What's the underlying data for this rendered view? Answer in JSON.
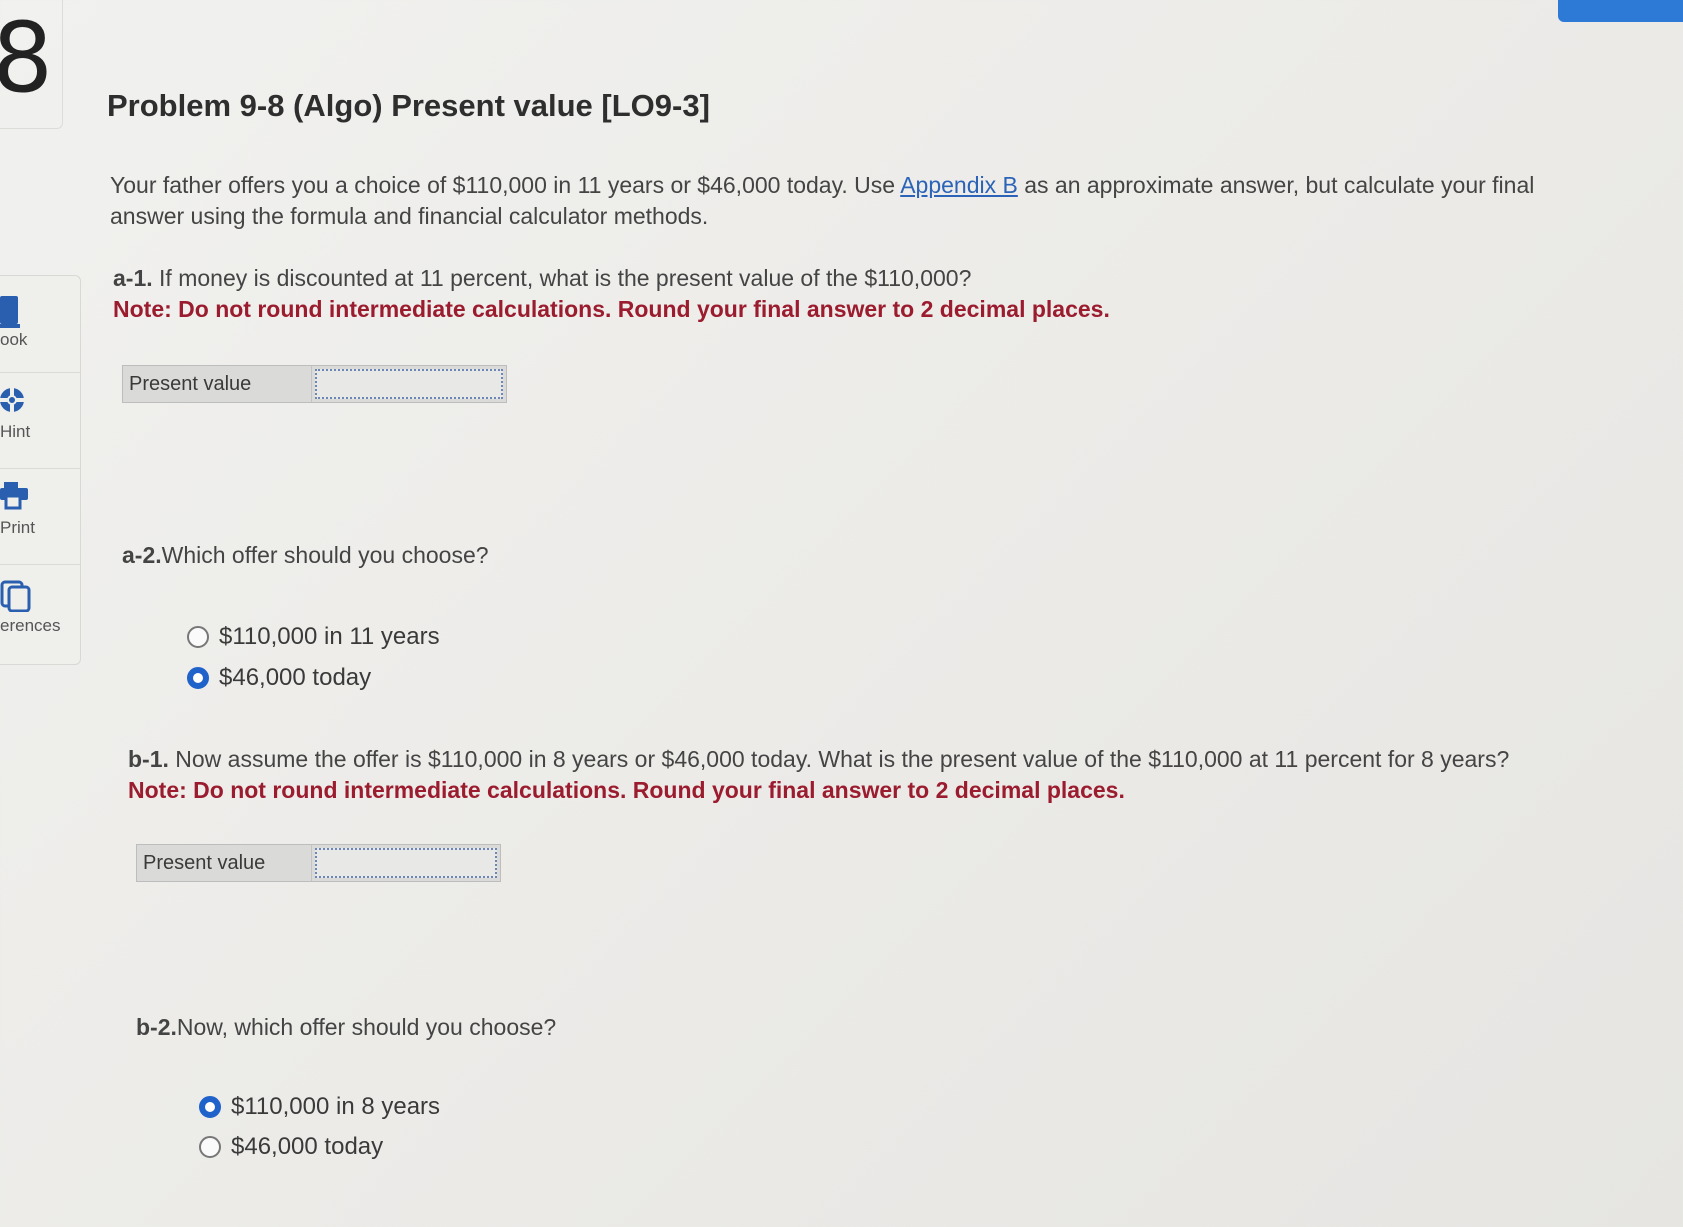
{
  "question_number": "8",
  "sidebar": {
    "items": [
      {
        "label": "ook",
        "icon": "book-icon"
      },
      {
        "label": "Hint",
        "icon": "hint-icon"
      },
      {
        "label": "Print",
        "icon": "print-icon"
      },
      {
        "label": "erences",
        "icon": "references-icon"
      }
    ]
  },
  "title": "Problem 9-8 (Algo) Present value [LO9-3]",
  "intro": {
    "before_link": "Your father offers you a choice of $110,000 in 11 years or $46,000 today. Use ",
    "link": "Appendix B",
    "after_link": " as an approximate answer, but calculate your final answer using the formula and financial calculator methods."
  },
  "a1": {
    "prefix": "a-1.",
    "question": " If money is discounted at 11 percent, what is the present value of the $110,000?",
    "note": "Note: Do not round intermediate calculations. Round your final answer to 2 decimal places.",
    "field_label": "Present value",
    "field_value": ""
  },
  "a2": {
    "prefix": "a-2.",
    "question": "Which offer should you choose?",
    "options": [
      {
        "label": "$110,000 in 11 years",
        "selected": false
      },
      {
        "label": "$46,000 today",
        "selected": true
      }
    ]
  },
  "b1": {
    "prefix": "b-1.",
    "question": " Now assume the offer is $110,000 in 8 years or $46,000 today. What is the present value of the $110,000 at 11 percent for 8 years?",
    "note": "Note: Do not round intermediate calculations. Round your final answer to 2 decimal places.",
    "field_label": "Present value",
    "field_value": ""
  },
  "b2": {
    "prefix": "b-2.",
    "question": "Now, which offer should you choose?",
    "options": [
      {
        "label": "$110,000 in 8 years",
        "selected": true
      },
      {
        "label": "$46,000 today",
        "selected": false
      }
    ]
  },
  "colors": {
    "accent": "#1f62c9",
    "note": "#9b1c2e",
    "link": "#2a63b7"
  }
}
